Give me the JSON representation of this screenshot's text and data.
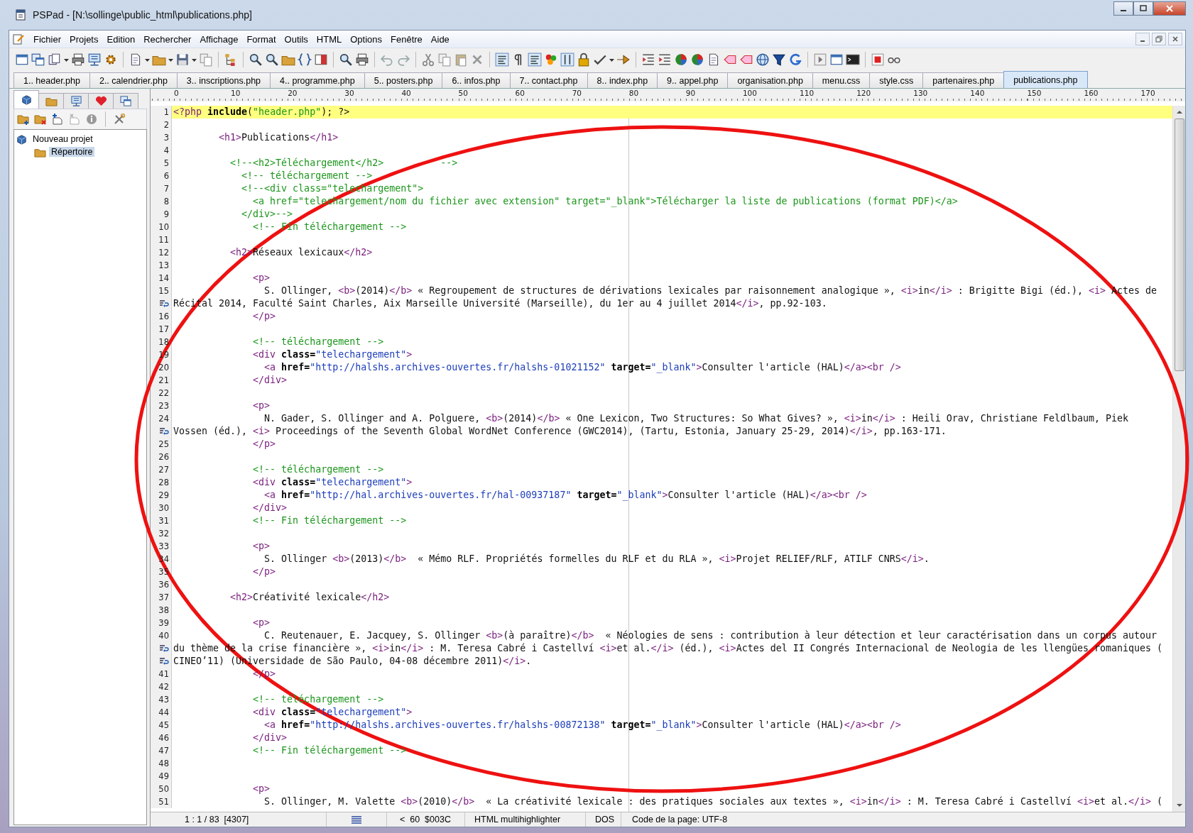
{
  "window": {
    "title": "PSPad - [N:\\sollinge\\public_html\\publications.php]"
  },
  "menu": [
    "Fichier",
    "Projets",
    "Edition",
    "Rechercher",
    "Affichage",
    "Format",
    "Outils",
    "HTML",
    "Options",
    "Fenêtre",
    "Aide"
  ],
  "tabs": [
    {
      "label": "1.. header.php",
      "selected": false
    },
    {
      "label": "2.. calendrier.php",
      "selected": false
    },
    {
      "label": "3.. inscriptions.php",
      "selected": false
    },
    {
      "label": "4.. programme.php",
      "selected": false
    },
    {
      "label": "5.. posters.php",
      "selected": false
    },
    {
      "label": "6.. infos.php",
      "selected": false
    },
    {
      "label": "7.. contact.php",
      "selected": false
    },
    {
      "label": "8.. index.php",
      "selected": false
    },
    {
      "label": "9.. appel.php",
      "selected": false
    },
    {
      "label": "organisation.php",
      "selected": false
    },
    {
      "label": "menu.css",
      "selected": false
    },
    {
      "label": "style.css",
      "selected": false
    },
    {
      "label": "partenaires.php",
      "selected": false
    },
    {
      "label": "publications.php",
      "selected": true
    }
  ],
  "sidebar": {
    "tabs": [
      {
        "kind": "project",
        "selected": true
      },
      {
        "kind": "folder",
        "selected": false
      },
      {
        "kind": "ftp",
        "selected": false
      },
      {
        "kind": "favorites",
        "selected": false
      },
      {
        "kind": "windows",
        "selected": false
      }
    ],
    "tree": [
      {
        "label": "Nouveau projet",
        "selected": false,
        "children": [
          {
            "label": "Répertoire",
            "selected": true
          }
        ]
      }
    ]
  },
  "ruler": [
    "0",
    "10",
    "20",
    "30",
    "40",
    "50",
    "60",
    "70",
    "80",
    "90",
    "100",
    "110",
    "120",
    "130",
    "140",
    "150",
    "160",
    "170"
  ],
  "lines": [
    {
      "kind": "line",
      "number": "1",
      "current": true,
      "segments": [
        {
          "kind": "tag",
          "text": "<?php "
        },
        {
          "kind": "keyword",
          "text": "include"
        },
        {
          "kind": "text",
          "text": "("
        },
        {
          "kind": "php-string",
          "text": "\"header.php\""
        },
        {
          "kind": "text",
          "text": "); ?>"
        }
      ]
    },
    {
      "kind": "line",
      "number": "2",
      "current": false
    },
    {
      "kind": "line",
      "number": "3",
      "current": false,
      "segments": [
        {
          "kind": "tag",
          "text": "        <h1>"
        },
        {
          "kind": "text",
          "text": "Publications"
        },
        {
          "kind": "tag",
          "text": "</h1>"
        }
      ]
    },
    {
      "kind": "line",
      "number": "4",
      "current": false
    },
    {
      "kind": "line",
      "number": "5",
      "current": false,
      "segments": [
        {
          "kind": "comment",
          "text": "          <!--<h2>Téléchargement</h2>          -->"
        }
      ]
    },
    {
      "kind": "line",
      "number": "6",
      "current": false,
      "segments": [
        {
          "kind": "comment",
          "text": "            <!-- téléchargement -->"
        }
      ]
    },
    {
      "kind": "line",
      "number": "7",
      "current": false,
      "segments": [
        {
          "kind": "comment",
          "text": "            <!--<div class=\"telechargement\">"
        }
      ]
    },
    {
      "kind": "line",
      "number": "8",
      "current": false,
      "segments": [
        {
          "kind": "comment",
          "text": "              <a href=\"telechargement/nom du fichier avec extension\" target=\"_blank\">Télécharger la liste de publications (format PDF)</a>"
        }
      ]
    },
    {
      "kind": "line",
      "number": "9",
      "current": false,
      "segments": [
        {
          "kind": "comment",
          "text": "            </div>-->"
        }
      ]
    },
    {
      "kind": "line",
      "number": "10",
      "current": false,
      "segments": [
        {
          "kind": "comment",
          "text": "              <!-- Fin téléchargement -->"
        }
      ]
    },
    {
      "kind": "line",
      "number": "11",
      "current": false
    },
    {
      "kind": "line",
      "number": "12",
      "current": false,
      "segments": [
        {
          "kind": "tag",
          "text": "          <h2>"
        },
        {
          "kind": "text",
          "text": "Réseaux lexicaux"
        },
        {
          "kind": "tag",
          "text": "</h2>"
        }
      ]
    },
    {
      "kind": "line",
      "number": "13",
      "current": false
    },
    {
      "kind": "line",
      "number": "14",
      "current": false,
      "segments": [
        {
          "kind": "tag",
          "text": "              <p>"
        }
      ]
    },
    {
      "kind": "line",
      "number": "15",
      "current": false,
      "segments": [
        {
          "kind": "text",
          "text": "                S. Ollinger, "
        },
        {
          "kind": "tag",
          "text": "<b>"
        },
        {
          "kind": "text",
          "text": "(2014)"
        },
        {
          "kind": "tag",
          "text": "</b>"
        },
        {
          "kind": "text",
          "text": " « Regroupement de structures de dérivations lexicales par raisonnement analogique », "
        },
        {
          "kind": "tag",
          "text": "<i>"
        },
        {
          "kind": "text",
          "text": "in"
        },
        {
          "kind": "tag",
          "text": "</i>"
        },
        {
          "kind": "text",
          "text": " : Brigitte Bigi (éd.), "
        },
        {
          "kind": "tag",
          "text": "<i>"
        },
        {
          "kind": "text",
          "text": " Actes de"
        }
      ]
    },
    {
      "kind": "wrap",
      "current": false,
      "segments": [
        {
          "kind": "text",
          "text": "Récital 2014, Faculté Saint Charles, Aix Marseille Université (Marseille), du 1er au 4 juillet 2014"
        },
        {
          "kind": "tag",
          "text": "</i>"
        },
        {
          "kind": "text",
          "text": ", pp.92-103."
        }
      ]
    },
    {
      "kind": "line",
      "number": "16",
      "current": false,
      "segments": [
        {
          "kind": "tag",
          "text": "              </p>"
        }
      ]
    },
    {
      "kind": "line",
      "number": "17",
      "current": false
    },
    {
      "kind": "line",
      "number": "18",
      "current": false,
      "segments": [
        {
          "kind": "comment",
          "text": "              <!-- téléchargement -->"
        }
      ]
    },
    {
      "kind": "line",
      "number": "19",
      "current": false,
      "segments": [
        {
          "kind": "tag",
          "text": "              <div "
        },
        {
          "kind": "attr",
          "text": "class="
        },
        {
          "kind": "string",
          "text": "\"telechargement\""
        },
        {
          "kind": "tag",
          "text": ">"
        }
      ]
    },
    {
      "kind": "line",
      "number": "20",
      "current": false,
      "segments": [
        {
          "kind": "tag",
          "text": "                <a "
        },
        {
          "kind": "attr",
          "text": "href="
        },
        {
          "kind": "string",
          "text": "\"http://halshs.archives-ouvertes.fr/halshs-01021152\""
        },
        {
          "kind": "attr",
          "text": " target="
        },
        {
          "kind": "string",
          "text": "\"_blank\""
        },
        {
          "kind": "tag",
          "text": ">"
        },
        {
          "kind": "text",
          "text": "Consulter l'article (HAL)"
        },
        {
          "kind": "tag",
          "text": "</a><br />"
        }
      ]
    },
    {
      "kind": "line",
      "number": "21",
      "current": false,
      "segments": [
        {
          "kind": "tag",
          "text": "              </div>"
        }
      ]
    },
    {
      "kind": "line",
      "number": "22",
      "current": false
    },
    {
      "kind": "line",
      "number": "23",
      "current": false,
      "segments": [
        {
          "kind": "tag",
          "text": "              <p>"
        }
      ]
    },
    {
      "kind": "line",
      "number": "24",
      "current": false,
      "segments": [
        {
          "kind": "text",
          "text": "                N. Gader, S. Ollinger and A. Polguere, "
        },
        {
          "kind": "tag",
          "text": "<b>"
        },
        {
          "kind": "text",
          "text": "(2014)"
        },
        {
          "kind": "tag",
          "text": "</b>"
        },
        {
          "kind": "text",
          "text": " « One Lexicon, Two Structures: So What Gives? », "
        },
        {
          "kind": "tag",
          "text": "<i>"
        },
        {
          "kind": "text",
          "text": "in"
        },
        {
          "kind": "tag",
          "text": "</i>"
        },
        {
          "kind": "text",
          "text": " : Heili Orav, Christiane Feldlbaum, Piek"
        }
      ]
    },
    {
      "kind": "wrap",
      "current": false,
      "segments": [
        {
          "kind": "text",
          "text": "Vossen (éd.), "
        },
        {
          "kind": "tag",
          "text": "<i>"
        },
        {
          "kind": "text",
          "text": " Proceedings of the Seventh Global WordNet Conference (GWC2014), (Tartu, Estonia, January 25-29, 2014)"
        },
        {
          "kind": "tag",
          "text": "</i>"
        },
        {
          "kind": "text",
          "text": ", pp.163-171."
        }
      ]
    },
    {
      "kind": "line",
      "number": "25",
      "current": false,
      "segments": [
        {
          "kind": "tag",
          "text": "              </p>"
        }
      ]
    },
    {
      "kind": "line",
      "number": "26",
      "current": false
    },
    {
      "kind": "line",
      "number": "27",
      "current": false,
      "segments": [
        {
          "kind": "comment",
          "text": "              <!-- téléchargement -->"
        }
      ]
    },
    {
      "kind": "line",
      "number": "28",
      "current": false,
      "segments": [
        {
          "kind": "tag",
          "text": "              <div "
        },
        {
          "kind": "attr",
          "text": "class="
        },
        {
          "kind": "string",
          "text": "\"telechargement\""
        },
        {
          "kind": "tag",
          "text": ">"
        }
      ]
    },
    {
      "kind": "line",
      "number": "29",
      "current": false,
      "segments": [
        {
          "kind": "tag",
          "text": "                <a "
        },
        {
          "kind": "attr",
          "text": "href="
        },
        {
          "kind": "string",
          "text": "\"http://hal.archives-ouvertes.fr/hal-00937187\""
        },
        {
          "kind": "attr",
          "text": " target="
        },
        {
          "kind": "string",
          "text": "\"_blank\""
        },
        {
          "kind": "tag",
          "text": ">"
        },
        {
          "kind": "text",
          "text": "Consulter l'article (HAL)"
        },
        {
          "kind": "tag",
          "text": "</a><br />"
        }
      ]
    },
    {
      "kind": "line",
      "number": "30",
      "current": false,
      "segments": [
        {
          "kind": "tag",
          "text": "              </div>"
        }
      ]
    },
    {
      "kind": "line",
      "number": "31",
      "current": false,
      "segments": [
        {
          "kind": "comment",
          "text": "              <!-- Fin téléchargement -->"
        }
      ]
    },
    {
      "kind": "line",
      "number": "32",
      "current": false
    },
    {
      "kind": "line",
      "number": "33",
      "current": false,
      "segments": [
        {
          "kind": "tag",
          "text": "              <p>"
        }
      ]
    },
    {
      "kind": "line",
      "number": "34",
      "current": false,
      "segments": [
        {
          "kind": "text",
          "text": "                S. Ollinger "
        },
        {
          "kind": "tag",
          "text": "<b>"
        },
        {
          "kind": "text",
          "text": "(2013)"
        },
        {
          "kind": "tag",
          "text": "</b>"
        },
        {
          "kind": "text",
          "text": "  « Mémo RLF. Propriétés formelles du RLF et du RLA », "
        },
        {
          "kind": "tag",
          "text": "<i>"
        },
        {
          "kind": "text",
          "text": "Projet RELIEF/RLF, ATILF CNRS"
        },
        {
          "kind": "tag",
          "text": "</i>"
        },
        {
          "kind": "text",
          "text": "."
        }
      ]
    },
    {
      "kind": "line",
      "number": "35",
      "current": false,
      "segments": [
        {
          "kind": "tag",
          "text": "              </p>"
        }
      ]
    },
    {
      "kind": "line",
      "number": "36",
      "current": false
    },
    {
      "kind": "line",
      "number": "37",
      "current": false,
      "segments": [
        {
          "kind": "tag",
          "text": "          <h2>"
        },
        {
          "kind": "text",
          "text": "Créativité lexicale"
        },
        {
          "kind": "tag",
          "text": "</h2>"
        }
      ]
    },
    {
      "kind": "line",
      "number": "38",
      "current": false
    },
    {
      "kind": "line",
      "number": "39",
      "current": false,
      "segments": [
        {
          "kind": "tag",
          "text": "              <p>"
        }
      ]
    },
    {
      "kind": "line",
      "number": "40",
      "current": false,
      "segments": [
        {
          "kind": "text",
          "text": "                C. Reutenauer, E. Jacquey, S. Ollinger "
        },
        {
          "kind": "tag",
          "text": "<b>"
        },
        {
          "kind": "text",
          "text": "(à paraître)"
        },
        {
          "kind": "tag",
          "text": "</b>"
        },
        {
          "kind": "text",
          "text": "  « Néologies de sens : contribution à leur détection et leur caractérisation dans un corpus autour"
        }
      ]
    },
    {
      "kind": "wrap",
      "current": false,
      "segments": [
        {
          "kind": "text",
          "text": "du thème de la crise financière », "
        },
        {
          "kind": "tag",
          "text": "<i>"
        },
        {
          "kind": "text",
          "text": "in"
        },
        {
          "kind": "tag",
          "text": "</i>"
        },
        {
          "kind": "text",
          "text": " : M. Teresa Cabré i Castellví "
        },
        {
          "kind": "tag",
          "text": "<i>"
        },
        {
          "kind": "text",
          "text": "et al."
        },
        {
          "kind": "tag",
          "text": "</i>"
        },
        {
          "kind": "text",
          "text": " (éd.), "
        },
        {
          "kind": "tag",
          "text": "<i>"
        },
        {
          "kind": "text",
          "text": "Actes del II Congrés Internacional de Neologia de les llengües romaniques ("
        }
      ]
    },
    {
      "kind": "wrap",
      "current": false,
      "segments": [
        {
          "kind": "text",
          "text": "CINEO’11) (Universidade de São Paulo, 04-08 décembre 2011)"
        },
        {
          "kind": "tag",
          "text": "</i>"
        },
        {
          "kind": "text",
          "text": "."
        }
      ]
    },
    {
      "kind": "line",
      "number": "41",
      "current": false,
      "segments": [
        {
          "kind": "tag",
          "text": "              </p>"
        }
      ]
    },
    {
      "kind": "line",
      "number": "42",
      "current": false
    },
    {
      "kind": "line",
      "number": "43",
      "current": false,
      "segments": [
        {
          "kind": "comment",
          "text": "              <!-- téléchargement -->"
        }
      ]
    },
    {
      "kind": "line",
      "number": "44",
      "current": false,
      "segments": [
        {
          "kind": "tag",
          "text": "              <div "
        },
        {
          "kind": "attr",
          "text": "class="
        },
        {
          "kind": "string",
          "text": "\"telechargement\""
        },
        {
          "kind": "tag",
          "text": ">"
        }
      ]
    },
    {
      "kind": "line",
      "number": "45",
      "current": false,
      "segments": [
        {
          "kind": "tag",
          "text": "                <a "
        },
        {
          "kind": "attr",
          "text": "href="
        },
        {
          "kind": "string",
          "text": "\"http://halshs.archives-ouvertes.fr/halshs-00872138\""
        },
        {
          "kind": "attr",
          "text": " target="
        },
        {
          "kind": "string",
          "text": "\"_blank\""
        },
        {
          "kind": "tag",
          "text": ">"
        },
        {
          "kind": "text",
          "text": "Consulter l'article (HAL)"
        },
        {
          "kind": "tag",
          "text": "</a><br />"
        }
      ]
    },
    {
      "kind": "line",
      "number": "46",
      "current": false,
      "segments": [
        {
          "kind": "tag",
          "text": "              </div>"
        }
      ]
    },
    {
      "kind": "line",
      "number": "47",
      "current": false,
      "segments": [
        {
          "kind": "comment",
          "text": "              <!-- Fin téléchargement -->"
        }
      ]
    },
    {
      "kind": "line",
      "number": "48",
      "current": false
    },
    {
      "kind": "line",
      "number": "49",
      "current": false
    },
    {
      "kind": "line",
      "number": "50",
      "current": false,
      "segments": [
        {
          "kind": "tag",
          "text": "              <p>"
        }
      ]
    },
    {
      "kind": "line",
      "number": "51",
      "current": false,
      "segments": [
        {
          "kind": "text",
          "text": "                S. Ollinger, M. Valette "
        },
        {
          "kind": "tag",
          "text": "<b>"
        },
        {
          "kind": "text",
          "text": "(2010)"
        },
        {
          "kind": "tag",
          "text": "</b>"
        },
        {
          "kind": "text",
          "text": "  « La créativité lexicale : des pratiques sociales aux textes », "
        },
        {
          "kind": "tag",
          "text": "<i>"
        },
        {
          "kind": "text",
          "text": "in"
        },
        {
          "kind": "tag",
          "text": "</i>"
        },
        {
          "kind": "text",
          "text": " : M. Teresa Cabré i Castellví "
        },
        {
          "kind": "tag",
          "text": "<i>"
        },
        {
          "kind": "text",
          "text": "et al."
        },
        {
          "kind": "tag",
          "text": "</i>"
        },
        {
          "kind": "text",
          "text": " ("
        }
      ]
    }
  ],
  "status_bar": {
    "position": "1 : 1 / 83  [4307]",
    "character": "<  60  $003C",
    "highlighter": "HTML multihighlighter",
    "line_endings": "DOS",
    "code_page": "Code de la page: UTF-8"
  }
}
